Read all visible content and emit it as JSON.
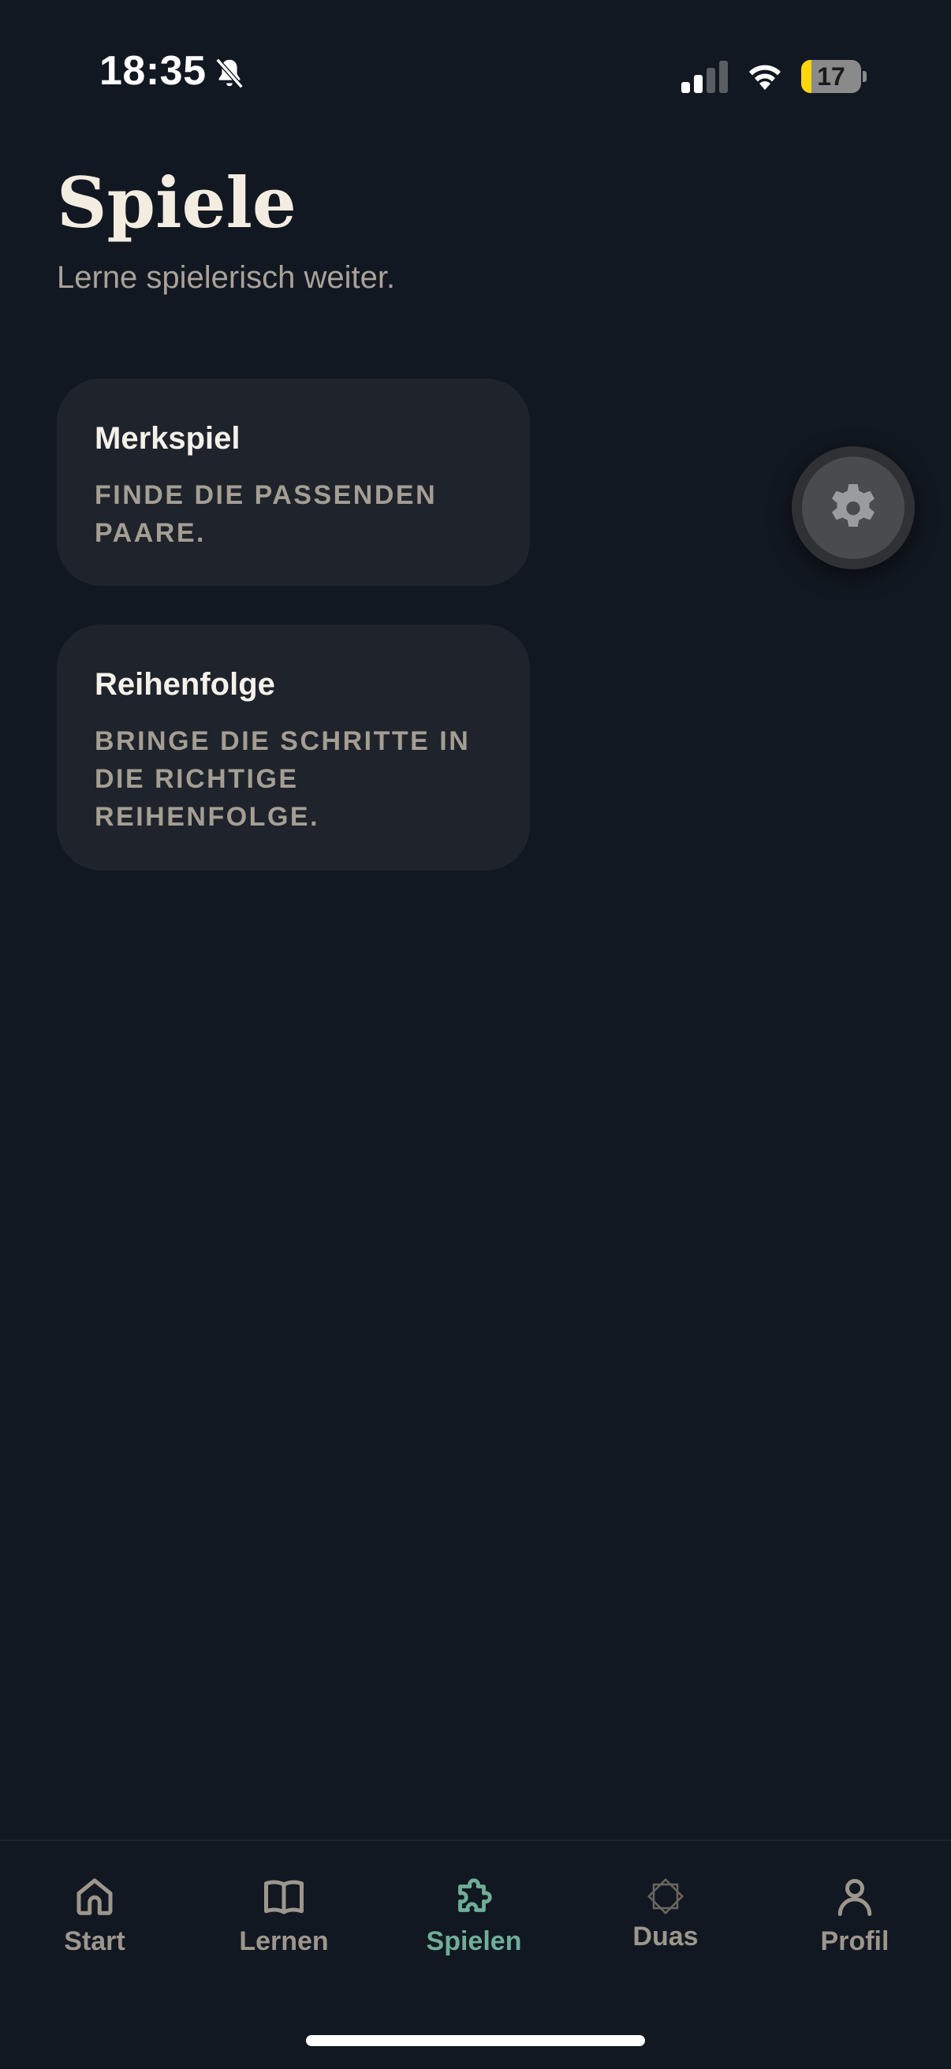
{
  "status_bar": {
    "time": "18:35",
    "battery_level": "17",
    "battery_fraction": 0.17,
    "icons": [
      "bell-slash-icon",
      "cellular-signal-icon",
      "wifi-icon",
      "battery-icon"
    ]
  },
  "header": {
    "title": "Spiele",
    "subtitle": "Lerne spielerisch weiter."
  },
  "games": [
    {
      "title": "Merkspiel",
      "description": "FINDE DIE PASSENDEN PAARE."
    },
    {
      "title": "Reihenfolge",
      "description": "BRINGE DIE SCHRITTE IN DIE RICHTIGE REIHENFOLGE."
    }
  ],
  "settings_button": {
    "icon": "gear-icon"
  },
  "tabs": [
    {
      "label": "Start",
      "icon": "home-icon",
      "active": false
    },
    {
      "label": "Lernen",
      "icon": "book-icon",
      "active": false
    },
    {
      "label": "Spielen",
      "icon": "puzzle-icon",
      "active": true
    },
    {
      "label": "Duas",
      "icon": "star-octagon-icon",
      "active": false
    },
    {
      "label": "Profil",
      "icon": "person-icon",
      "active": false
    }
  ],
  "colors": {
    "background": "#121821",
    "card": "#1f232b",
    "title": "#f3ece0",
    "muted_text": "#a49e93",
    "accent": "#6fae98",
    "battery_warning": "#ffd60a"
  }
}
